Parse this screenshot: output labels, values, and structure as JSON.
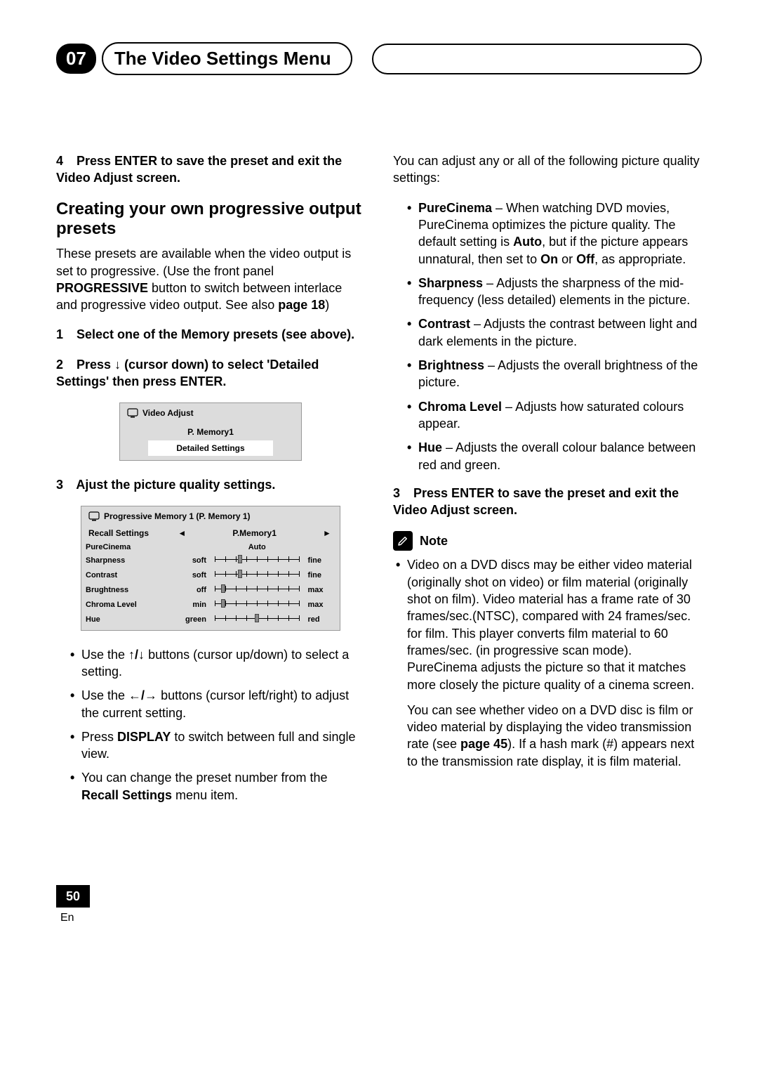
{
  "header": {
    "chapter_num": "07",
    "title": "The Video Settings Menu"
  },
  "left": {
    "step4_num": "4",
    "step4_text": "Press ENTER to save the preset and exit the Video Adjust screen.",
    "h2": "Creating your own progressive output presets",
    "intro_a": "These presets are available when the video output is set to progressive. (Use the front panel ",
    "intro_prog": "PROGRESSIVE",
    "intro_b": " button to switch between interlace and progressive video output. See also ",
    "intro_page": "page 18",
    "intro_c": ")",
    "step1_num": "1",
    "step1_text": "Select one of the Memory presets (see above).",
    "step2_num": "2",
    "step2_text_a": "Press ",
    "step2_arrow": "↓",
    "step2_text_b": " (cursor down) to select 'Detailed Settings' then press ENTER.",
    "osd1": {
      "title": "Video Adjust",
      "row1": "P. Memory1",
      "row2": "Detailed Settings"
    },
    "step3_num": "3",
    "step3_text": "Ajust the picture quality settings.",
    "osd2": {
      "title": "Progressive Memory 1 (P. Memory 1)",
      "recall_label": "Recall Settings",
      "recall_value": "P.Memory1",
      "rows": [
        {
          "label": "PureCinema",
          "left": "",
          "right": "",
          "center": "Auto",
          "slider": false
        },
        {
          "label": "Sharpness",
          "left": "soft",
          "right": "fine",
          "pos": 30,
          "slider": true
        },
        {
          "label": "Contrast",
          "left": "soft",
          "right": "fine",
          "pos": 30,
          "slider": true
        },
        {
          "label": "Brughtness",
          "left": "off",
          "right": "max",
          "pos": 10,
          "slider": true
        },
        {
          "label": "Chroma Level",
          "left": "min",
          "right": "max",
          "pos": 10,
          "slider": true
        },
        {
          "label": "Hue",
          "left": "green",
          "right": "red",
          "pos": 50,
          "slider": true
        }
      ]
    },
    "bullets": {
      "b1_a": "Use the ",
      "b1_arrows": "↑/↓",
      "b1_b": " buttons (cursor up/down) to select a setting.",
      "b2_a": "Use the ",
      "b2_arrows": "←/→",
      "b2_b": " buttons (cursor left/right) to adjust the current setting.",
      "b3_a": "Press ",
      "b3_disp": "DISPLAY",
      "b3_b": " to switch between full and single view.",
      "b4_a": "You can change the preset number from the ",
      "b4_recall": "Recall Settings",
      "b4_b": " menu item."
    }
  },
  "right": {
    "intro": "You can adjust any or all of the following picture quality settings:",
    "settings": {
      "purecinema_name": "PureCinema",
      "purecinema_a": " – When watching DVD movies, PureCinema optimizes the picture quality. The default setting is ",
      "purecinema_auto": "Auto",
      "purecinema_b": ", but if the picture appears unnatural, then set to ",
      "purecinema_on": "On",
      "purecinema_or": " or ",
      "purecinema_off": "Off",
      "purecinema_c": ", as appropriate.",
      "sharp_name": "Sharpness",
      "sharp_t": " – Adjusts the sharpness of the mid-frequency (less detailed) elements in the picture.",
      "contrast_name": "Contrast",
      "contrast_t": " – Adjusts the contrast between light and dark elements in the picture.",
      "bright_name": "Brightness",
      "bright_t": " – Adjusts the overall brightness of the picture.",
      "chroma_name": "Chroma Level",
      "chroma_t": " – Adjusts how saturated colours appear.",
      "hue_name": "Hue",
      "hue_t": " – Adjusts the overall colour balance between red and green."
    },
    "step3_num": "3",
    "step3_text": "Press ENTER to save the preset and exit the Video Adjust screen.",
    "note_label": "Note",
    "note_p1_a": "Video on a DVD discs may be either video material (originally shot on video) or film material (originally shot on film). Video material has a frame rate of 30 frames/sec.(NTSC), compared with 24 frames/sec. for film. This player converts film material to 60 frames/sec. (in progressive scan mode). PureCinema adjusts the picture so that it matches more closely the picture quality of a cinema screen.",
    "note_p2_a": "You can see whether video on a DVD disc is film or video material by displaying the video transmission rate (see ",
    "note_p2_page": "page 45",
    "note_p2_b": "). If a hash mark (#) appears next to the transmission rate display, it is film material."
  },
  "footer": {
    "page": "50",
    "lang": "En"
  }
}
